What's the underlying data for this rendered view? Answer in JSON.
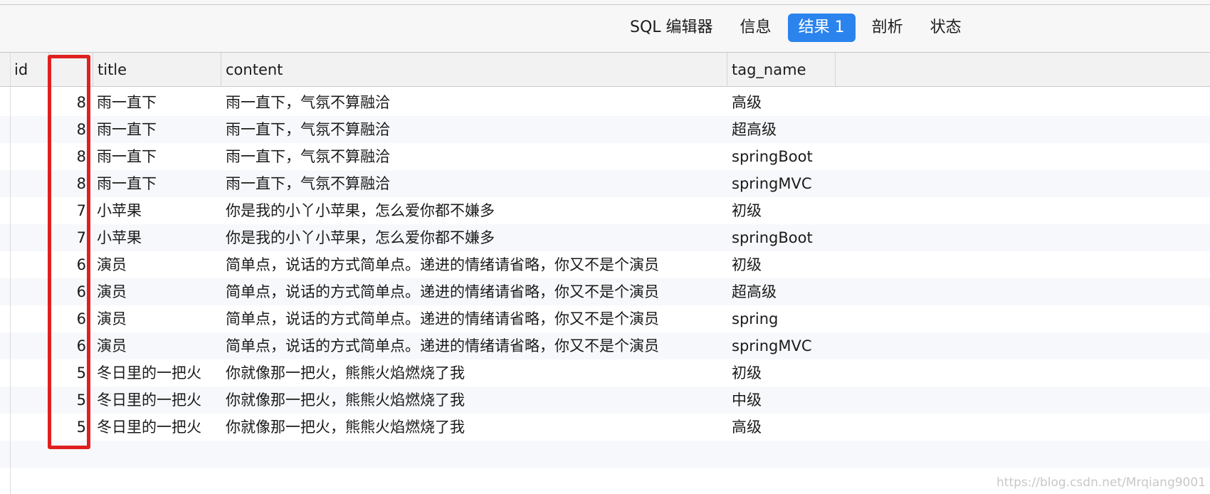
{
  "toolbar": {
    "tabs": [
      {
        "label": "SQL 编辑器"
      },
      {
        "label": "信息"
      },
      {
        "label": "结果 1"
      },
      {
        "label": "剖析"
      },
      {
        "label": "状态"
      }
    ],
    "active_tab": "结果 1"
  },
  "table": {
    "columns": [
      "id",
      "",
      "title",
      "content",
      "tag_name"
    ],
    "rows": [
      {
        "num": "8",
        "title": "雨一直下",
        "content": "雨一直下，气氛不算融洽",
        "tag": "高级"
      },
      {
        "num": "8",
        "title": "雨一直下",
        "content": "雨一直下，气氛不算融洽",
        "tag": "超高级"
      },
      {
        "num": "8",
        "title": "雨一直下",
        "content": "雨一直下，气氛不算融洽",
        "tag": "springBoot"
      },
      {
        "num": "8",
        "title": "雨一直下",
        "content": "雨一直下，气氛不算融洽",
        "tag": "springMVC"
      },
      {
        "num": "7",
        "title": "小苹果",
        "content": "你是我的小丫小苹果，怎么爱你都不嫌多",
        "tag": "初级"
      },
      {
        "num": "7",
        "title": "小苹果",
        "content": "你是我的小丫小苹果，怎么爱你都不嫌多",
        "tag": "springBoot"
      },
      {
        "num": "6",
        "title": "演员",
        "content": "简单点，说话的方式简单点。递进的情绪请省略，你又不是个演员",
        "tag": "初级"
      },
      {
        "num": "6",
        "title": "演员",
        "content": "简单点，说话的方式简单点。递进的情绪请省略，你又不是个演员",
        "tag": "超高级"
      },
      {
        "num": "6",
        "title": "演员",
        "content": "简单点，说话的方式简单点。递进的情绪请省略，你又不是个演员",
        "tag": "spring"
      },
      {
        "num": "6",
        "title": "演员",
        "content": "简单点，说话的方式简单点。递进的情绪请省略，你又不是个演员",
        "tag": "springMVC"
      },
      {
        "num": "5",
        "title": "冬日里的一把火",
        "content": "你就像那一把火，熊熊火焰燃烧了我",
        "tag": "初级"
      },
      {
        "num": "5",
        "title": "冬日里的一把火",
        "content": "你就像那一把火，熊熊火焰燃烧了我",
        "tag": "中级"
      },
      {
        "num": "5",
        "title": "冬日里的一把火",
        "content": "你就像那一把火，熊熊火焰燃烧了我",
        "tag": "高级"
      }
    ]
  },
  "highlight_color": "#e02020",
  "accent_color": "#2b84ee",
  "watermark": "https://blog.csdn.net/Mrqiang9001"
}
